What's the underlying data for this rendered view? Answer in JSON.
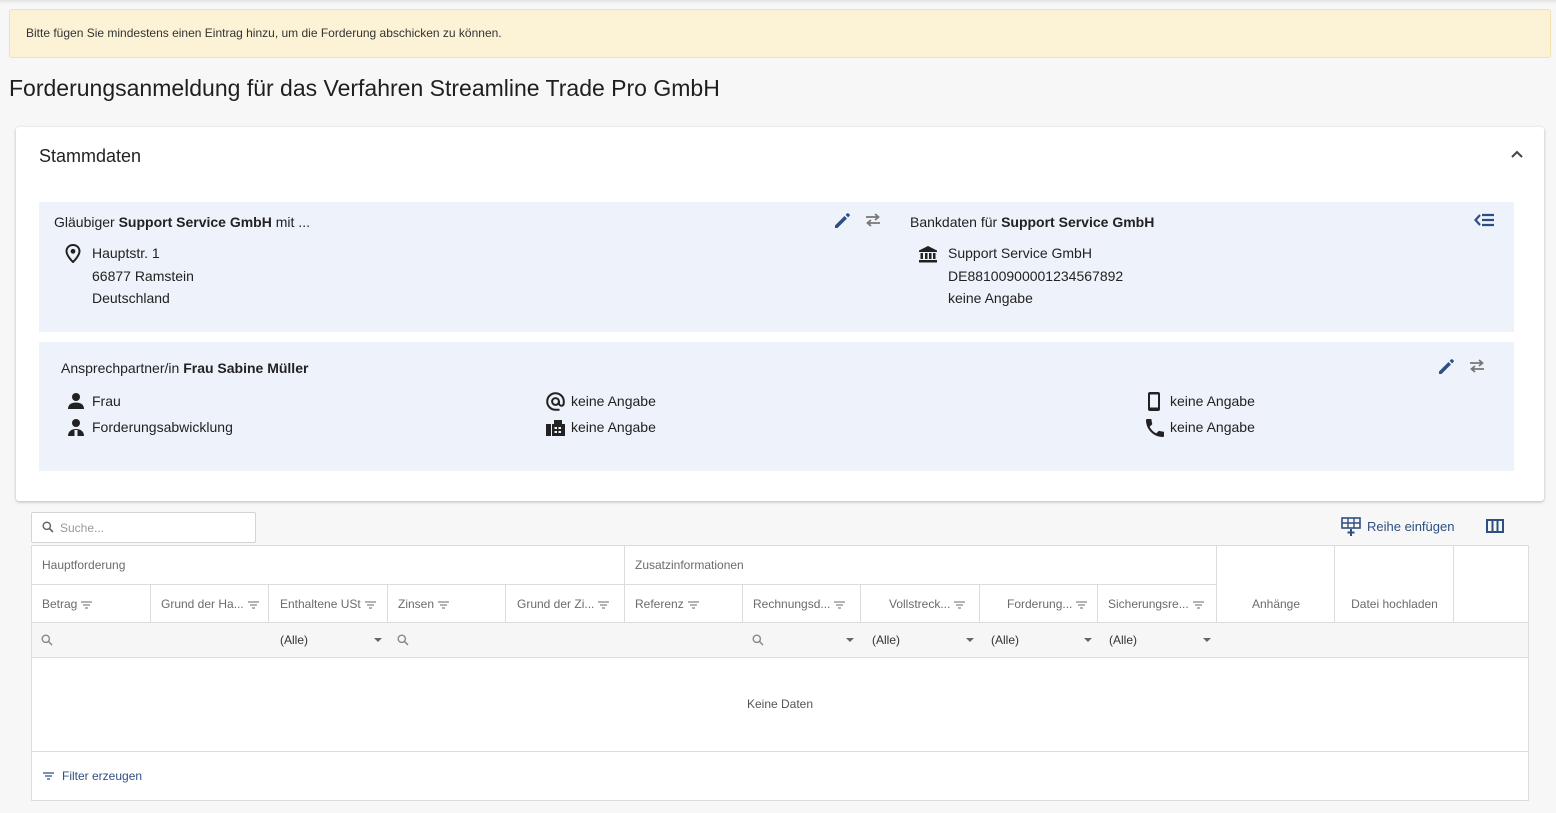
{
  "alert": {
    "message": "Bitte fügen Sie mindestens einen Eintrag hinzu, um die Forderung abschicken zu können."
  },
  "page": {
    "title": "Forderungsanmeldung für das Verfahren Streamline Trade Pro GmbH"
  },
  "stammdaten": {
    "title": "Stammdaten",
    "glaeubiger": {
      "label_prefix": "Gläubiger",
      "name": "Support Service GmbH",
      "label_suffix": "mit ...",
      "address": [
        "Hauptstr. 1",
        "66877 Ramstein",
        "Deutschland"
      ]
    },
    "bank": {
      "label_prefix": "Bankdaten für",
      "name": "Support Service GmbH",
      "lines": [
        "Support Service GmbH",
        "DE88100900001234567892",
        "keine Angabe"
      ]
    },
    "contact": {
      "label_prefix": "Ansprechpartner/in",
      "name": "Frau Sabine Müller",
      "salutation": "Frau",
      "department": "Forderungsabwicklung",
      "email": "keine Angabe",
      "fax": "keine Angabe",
      "mobile": "keine Angabe",
      "phone": "keine Angabe"
    }
  },
  "toolbar": {
    "search_placeholder": "Suche...",
    "add_row_label": "Reihe einfügen"
  },
  "grid": {
    "bands": [
      "Hauptforderung",
      "Zusatzinformationen"
    ],
    "columns": [
      "Betrag",
      "Grund der Ha...",
      "Enthaltene USt",
      "Zinsen",
      "Grund der Zi...",
      "Referenz",
      "Rechnungsd...",
      "Vollstreck...",
      "Forderung...",
      "Sicherungsre...",
      "Anhänge",
      "Datei hochladen"
    ],
    "filters": {
      "ust": "(Alle)",
      "vollstreck": "(Alle)",
      "forderung": "(Alle)",
      "sicherung": "(Alle)"
    },
    "empty_text": "Keine Daten",
    "filter_button": "Filter erzeugen"
  },
  "colors": {
    "accent": "#2e4f82",
    "panel_bg": "#eef3fb",
    "alert_bg": "#fcf2d6"
  }
}
